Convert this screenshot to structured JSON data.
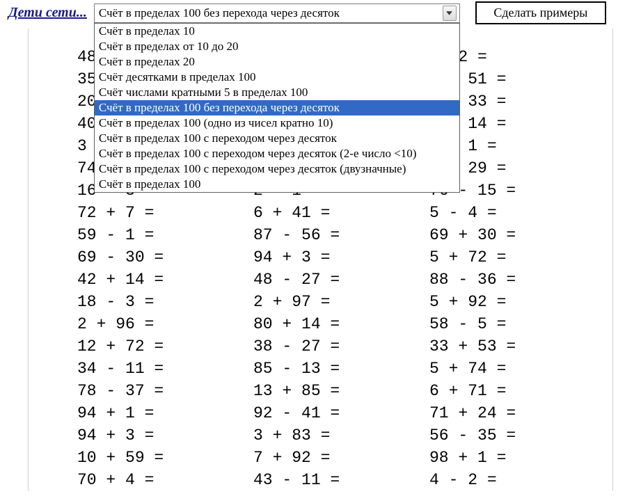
{
  "header": {
    "brand": "Дети сети...",
    "select_value": "Счёт в пределах 100 без перехода через десяток",
    "button_label": "Сделать примеры",
    "options": [
      "Счёт в пределах 10",
      "Счёт в пределах от 10 до 20",
      "Счёт в пределах 20",
      "Счёт десятками в пределах 100",
      "Счёт числами кратными 5 в пределах 100",
      "Счёт в пределах 100 без перехода через десяток",
      "Счёт в пределах 100 (одно из чисел кратно 10)",
      "Счёт в пределах 100 с переходом через десяток",
      "Счёт в пределах 100 с переходом через десяток (2-е число <10)",
      "Счёт в пределах 100 с переходом через десяток (двузначные)",
      "Счёт в пределах 100"
    ],
    "selected_index": 5
  },
  "columns": [
    [
      "48",
      "35",
      "20",
      "40",
      "3 +",
      "74",
      "16 - 3 =",
      "72 + 7 =",
      "59 - 1 =",
      "69 - 30 =",
      "42 + 14 =",
      "18 - 3 =",
      "2 + 96 =",
      "12 + 72 =",
      "34 - 11 =",
      "78 - 37 =",
      "94 + 1 =",
      "94 + 3 =",
      "10 + 59 =",
      "70 + 4 ="
    ],
    [
      "",
      "",
      "",
      "",
      "",
      "",
      "2 - 1 =",
      "6 + 41 =",
      "87 - 56 =",
      "94 + 3 =",
      "48 - 27 =",
      "2 + 97 =",
      "80 + 14 =",
      "38 - 27 =",
      "85 - 13 =",
      "13 + 85 =",
      "92 - 41 =",
      "3 + 83 =",
      "7 + 92 =",
      "43 - 11 ="
    ],
    [
      " - 2 =",
      "3 + 51 =",
      "5 + 33 =",
      "9 - 14 =",
      "  - 1 =",
      "9 - 29 =",
      "76 - 15 =",
      "5 - 4 =",
      "69 + 30 =",
      "5 + 72 =",
      "88 - 36 =",
      "5 + 92 =",
      "58 - 5 =",
      "33 + 53 =",
      "5 + 74 =",
      "6 + 71 =",
      "71 + 24 =",
      "56 - 35 =",
      "98 + 1 =",
      "4 - 2 ="
    ]
  ]
}
